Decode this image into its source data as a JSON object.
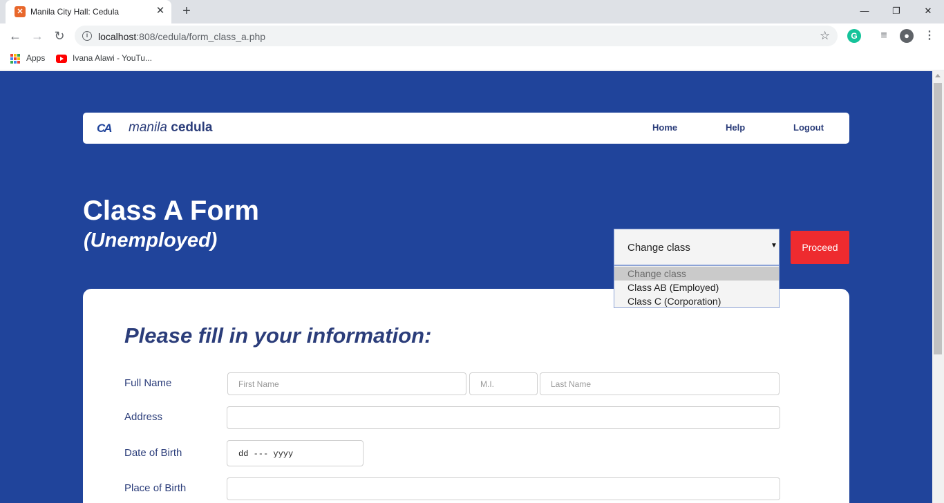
{
  "browser": {
    "tab_title": "Manila City Hall: Cedula",
    "new_tab": "+",
    "url_host": "localhost",
    "url_path": ":808/cedula/form_class_a.php",
    "bookmarks": [
      {
        "label": "Apps",
        "icon": "apps-grid-icon"
      },
      {
        "label": "Ivana Alawi - YouTu...",
        "icon": "youtube-icon"
      }
    ],
    "extensions": {
      "grammarly": "G"
    }
  },
  "site": {
    "logo_mark": "CA",
    "logo_word1": "manila",
    "logo_word2": "cedula",
    "nav": [
      "Home",
      "Help",
      "Logout"
    ]
  },
  "page": {
    "title": "Class A Form",
    "subtitle": "(Unemployed)"
  },
  "class_select": {
    "value": "Change class",
    "options": [
      "Change class",
      "Class AB (Employed)",
      "Class C (Corporation)"
    ],
    "proceed": "Proceed"
  },
  "form": {
    "heading": "Please fill in your information:",
    "labels": {
      "full_name": "Full Name",
      "address": "Address",
      "dob": "Date of Birth",
      "pob": "Place of Birth"
    },
    "placeholders": {
      "first_name": "First Name",
      "mi": "M.I.",
      "last_name": "Last Name"
    },
    "dob_value": "dd --- yyyy"
  },
  "colors": {
    "background": "#20449b",
    "accent_red": "#ee2b2f",
    "text_navy": "#2b3d7a"
  }
}
